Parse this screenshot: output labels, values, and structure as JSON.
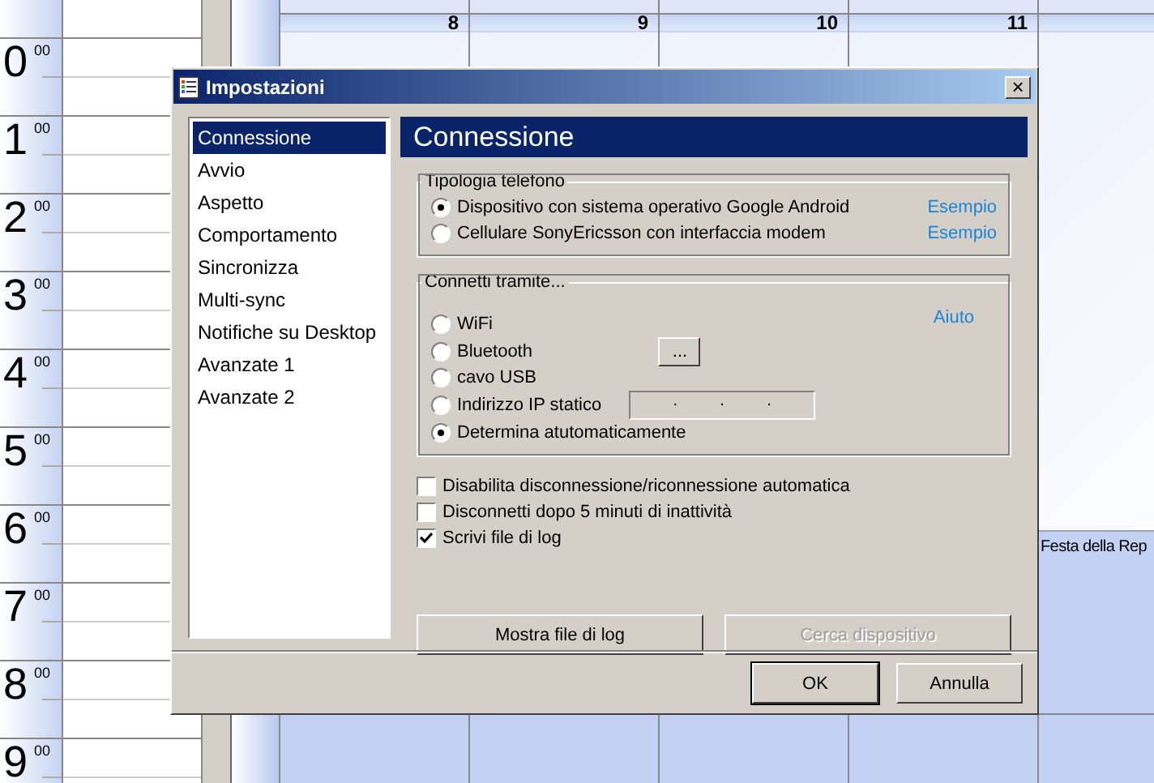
{
  "calendar": {
    "hours": [
      {
        "hour": "0",
        "minutes": "00"
      },
      {
        "hour": "1",
        "minutes": "00"
      },
      {
        "hour": "2",
        "minutes": "00"
      },
      {
        "hour": "3",
        "minutes": "00"
      },
      {
        "hour": "4",
        "minutes": "00"
      },
      {
        "hour": "5",
        "minutes": "00"
      },
      {
        "hour": "6",
        "minutes": "00"
      },
      {
        "hour": "7",
        "minutes": "00"
      },
      {
        "hour": "8",
        "minutes": "00"
      },
      {
        "hour": "9",
        "minutes": "00"
      }
    ],
    "days": [
      {
        "label": "8"
      },
      {
        "label": "9"
      },
      {
        "label": "10"
      },
      {
        "label": "11"
      },
      {
        "event": "Festa della Rep"
      }
    ]
  },
  "dialog": {
    "title": "Impostazioni",
    "close": "×",
    "nav_items": [
      {
        "label": "Connessione",
        "selected": true
      },
      {
        "label": "Avvio",
        "selected": false
      },
      {
        "label": "Aspetto",
        "selected": false
      },
      {
        "label": "Comportamento",
        "selected": false
      },
      {
        "label": "Sincronizza",
        "selected": false
      },
      {
        "label": "Multi-sync",
        "selected": false
      },
      {
        "label": "Notifiche su Desktop",
        "selected": false
      },
      {
        "label": "Avanzate 1",
        "selected": false
      },
      {
        "label": "Avanzate 2",
        "selected": false
      }
    ],
    "panel_title": "Connessione",
    "phone_type": {
      "title": "Tipologia telefono",
      "options": [
        {
          "label": "Dispositivo con sistema operativo Google Android",
          "selected": true,
          "link": "Esempio"
        },
        {
          "label": "Cellulare SonyEricsson con interfaccia modem",
          "selected": false,
          "link": "Esempio"
        }
      ]
    },
    "connect_via": {
      "title": "Connetti tramite...",
      "help_link": "Aiuto",
      "options": [
        {
          "kind": "plain",
          "label": "WiFi",
          "selected": false
        },
        {
          "kind": "browse",
          "label": "Bluetooth",
          "selected": false,
          "button": "..."
        },
        {
          "kind": "plain",
          "label": "cavo USB",
          "selected": false
        },
        {
          "kind": "ip",
          "label": "Indirizzo IP statico",
          "selected": false,
          "dots": [
            ".",
            ".",
            "."
          ]
        },
        {
          "kind": "plain",
          "label": "Determina atutomaticamente",
          "selected": true
        }
      ]
    },
    "checkboxes": [
      {
        "label": "Disabilita disconnessione/riconnessione automatica",
        "checked": false
      },
      {
        "label": "Disconnetti dopo 5 minuti di inattività",
        "checked": false
      },
      {
        "label": "Scrivi file di log",
        "checked": true
      }
    ],
    "actions": [
      {
        "label": "Mostra file di log",
        "disabled": false
      },
      {
        "label": "Cerca dispositivo",
        "disabled": true
      }
    ],
    "footer_buttons": [
      {
        "label": "OK",
        "default": true
      },
      {
        "label": "Annulla",
        "default": false
      }
    ]
  }
}
